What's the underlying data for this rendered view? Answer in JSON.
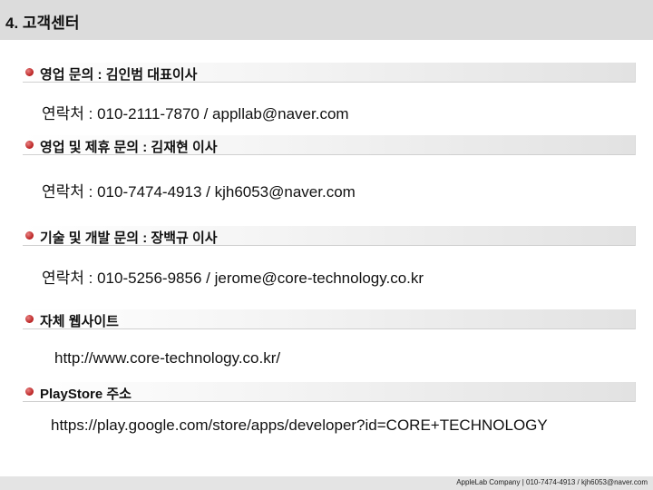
{
  "header": {
    "title": "4. 고객센터"
  },
  "sections": [
    {
      "title": "영업 문의 : 김인범 대표이사",
      "detail": "연락처 : 010-2111-7870 / appllab@naver.com"
    },
    {
      "title": "영업 및 제휴 문의 : 김재현 이사",
      "detail": "연락처 : 010-7474-4913 / kjh6053@naver.com"
    },
    {
      "title": "기술 및 개발 문의 : 장백규 이사",
      "detail": "연락처 : 010-5256-9856 / jerome@core-technology.co.kr"
    },
    {
      "title": "자체 웹사이트",
      "detail": "http://www.core-technology.co.kr/"
    },
    {
      "title": "PlayStore 주소",
      "detail": "https://play.google.com/store/apps/developer?id=CORE+TECHNOLOGY"
    }
  ],
  "footer": {
    "text": "AppleLab Company | 010-7474-4913 / kjh6053@naver.com"
  },
  "colors": {
    "header_bg": "#dcdcdc",
    "bullet": "#b81e1e",
    "footer_bg": "#e4e4e4"
  }
}
